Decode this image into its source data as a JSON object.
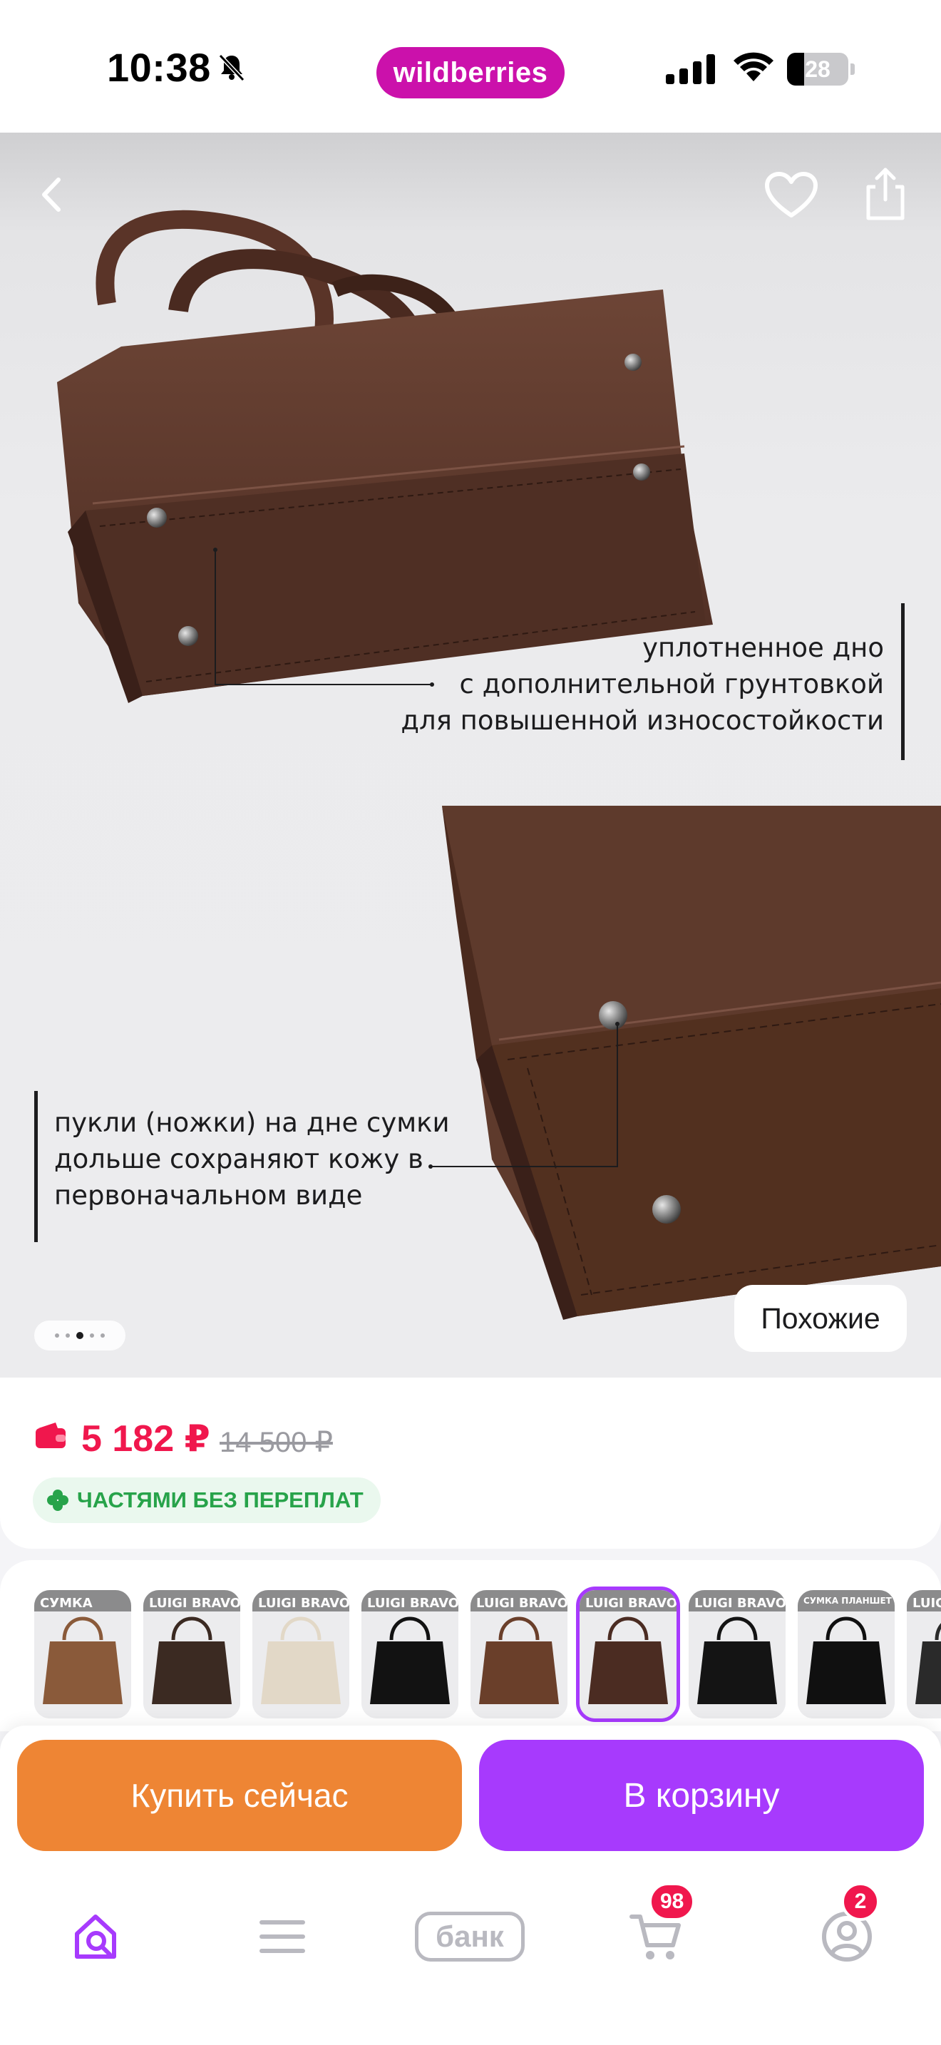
{
  "status_bar": {
    "time": "10:38",
    "brand": "wildberries",
    "battery_level": "28",
    "battery_fraction": 0.28
  },
  "gallery": {
    "caption_1": [
      "уплотненное дно",
      "с дополнительной грунтовкой",
      "для повышенной износостойкости"
    ],
    "caption_2": [
      "пукли (ножки) на дне сумки",
      "дольше сохраняют кожу в",
      "первоначальном виде"
    ],
    "similar_label": "Похожие",
    "page_dots": 5,
    "active_dot": 2
  },
  "price": {
    "current": "5 182 ₽",
    "old": "14 500 ₽",
    "installments": "ЧАСТЯМИ БЕЗ ПЕРЕПЛАТ"
  },
  "variants": [
    {
      "label": "СУМКА",
      "color": "#8a5a3a",
      "selected": false
    },
    {
      "label": "LUIGI BRAVO",
      "color": "#3b2a22",
      "selected": false
    },
    {
      "label": "LUIGI BRAVO",
      "color": "#e2d8c7",
      "selected": false
    },
    {
      "label": "LUIGI BRAVO",
      "color": "#121212",
      "selected": false
    },
    {
      "label": "LUIGI BRAVO",
      "color": "#6a3f2a",
      "selected": false
    },
    {
      "label": "LUIGI BRAVO",
      "color": "#4b2c22",
      "selected": true
    },
    {
      "label": "LUIGI BRAVO",
      "color": "#141414",
      "selected": false
    },
    {
      "label": "СУМКА ПЛАНШЕТ ОТ LUIGI BRAVO",
      "color": "#101010",
      "selected": false
    },
    {
      "label": "LUIGI",
      "color": "#2a2a2a",
      "selected": false
    }
  ],
  "actions": {
    "buy_now": "Купить сейчас",
    "add_to_cart": "В корзину"
  },
  "tab_bar": {
    "bank_label": "банк",
    "cart_badge": "98",
    "profile_badge": "2",
    "accent": "#a73afd"
  },
  "colors": {
    "brand": "#cb11ab",
    "price": "#f0174d",
    "buy_now": "#ee8534",
    "cart": "#a73afd",
    "leather": "#5e3a2c"
  }
}
